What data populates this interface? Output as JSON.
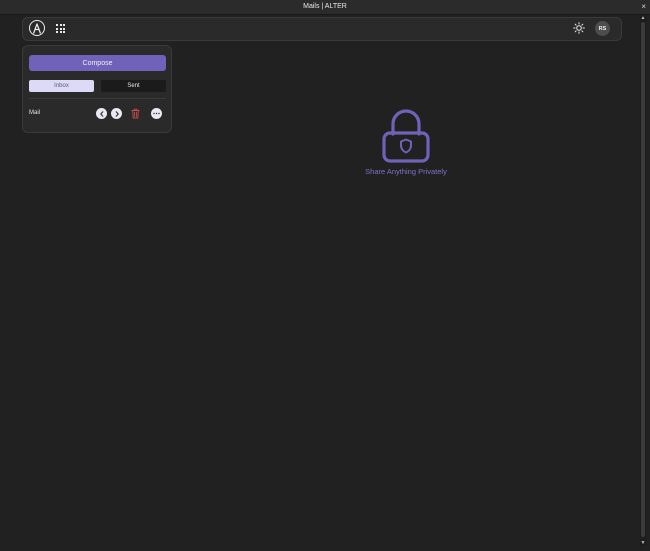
{
  "window": {
    "title": "Mails | ALTER",
    "close_label": "×"
  },
  "navbar": {
    "logo_icon": "alter-logo-icon",
    "apps_icon": "apps-grid-icon",
    "theme_icon": "sun-icon",
    "avatar_initials": "RS"
  },
  "panel": {
    "compose_label": "Compose",
    "tabs": [
      {
        "label": "Inbox",
        "active": true
      },
      {
        "label": "Sent",
        "active": false
      }
    ],
    "mail_label": "Mail",
    "controls": [
      "chevron-left-icon",
      "chevron-right-icon",
      "trash-icon",
      "more-icon"
    ]
  },
  "hero": {
    "icon": "lock-shield-icon",
    "text": "Share Anything Privately"
  },
  "colors": {
    "background": "#212121",
    "accent": "#6f62b8",
    "accent_text": "#7e73cc",
    "danger": "#c84b4b",
    "active_tab": "#dcdaf6"
  }
}
